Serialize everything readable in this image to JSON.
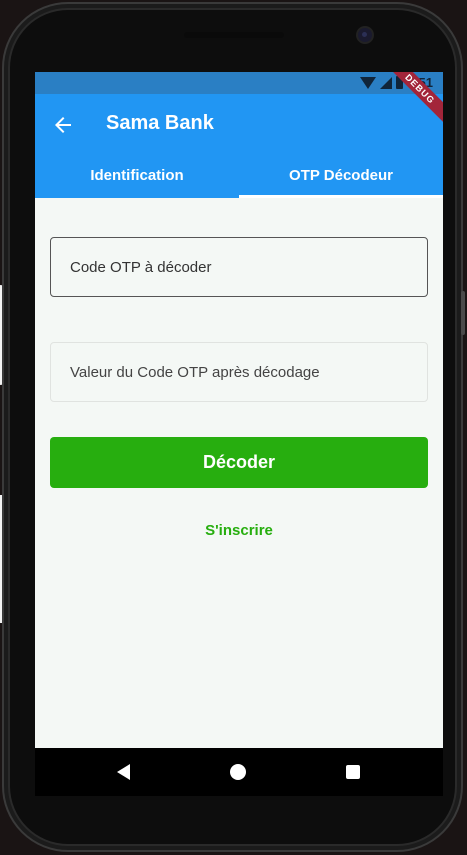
{
  "status_bar": {
    "time": "5:51",
    "icons": [
      "wifi-icon",
      "signal-icon",
      "battery-icon"
    ]
  },
  "debug_banner": "DEBUG",
  "app_bar": {
    "title": "Sama Bank",
    "back_icon": "arrow-left-icon"
  },
  "tabs": [
    {
      "label": "Identification",
      "active": false
    },
    {
      "label": "OTP Décodeur",
      "active": true
    }
  ],
  "form": {
    "otp_code_placeholder": "Code OTP à décoder",
    "decoded_value_placeholder": "Valeur du Code OTP après décodage"
  },
  "buttons": {
    "decode_label": "Décoder",
    "signup_label": "S'inscrire"
  },
  "nav_bar": {
    "icons": [
      "nav-back-icon",
      "nav-home-icon",
      "nav-recent-icon"
    ]
  },
  "colors": {
    "primary": "#2196f3",
    "status_bar": "#2a7fc4",
    "accent_green": "#27ae0f",
    "background": "#f4f8f5"
  }
}
